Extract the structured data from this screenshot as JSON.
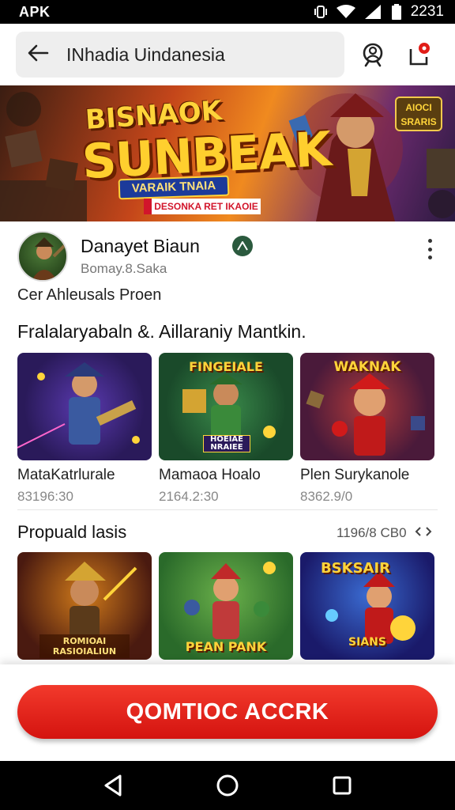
{
  "status_bar": {
    "left_text": "APK",
    "time": "2231"
  },
  "header": {
    "search_text": "INhadia Uindanesia"
  },
  "banner": {
    "title_top": "BISNAOK",
    "title_main": "SUNBEAK",
    "ribbon_text": "VARAIK TNAIA",
    "red_text": "DESONKA RET IKAOIE",
    "badge_text": "AIOCI SRARIS"
  },
  "developer": {
    "name": "Danayet Biaun",
    "subtitle": "Bomay.8.Saka",
    "category": "Cer Ahleusals Proen"
  },
  "featured": {
    "title": "Fralalaryabaln &. Aillaraniy Mantkin.",
    "items": [
      {
        "name": "MataKatrlurale",
        "meta": "83196:30"
      },
      {
        "name": "Mamaoa Hoalo",
        "meta": "2164.2:30"
      },
      {
        "name": "Plen Surykanole",
        "meta": "8362.9/0"
      }
    ],
    "art_labels": [
      "",
      "FINGEIALE",
      "WAKNAK"
    ],
    "art_sublabels": [
      "",
      "HOEIAE NRAIEE",
      ""
    ]
  },
  "popular": {
    "title": "Propuald lasis",
    "right_text": "1196/8 CB0",
    "art_labels": [
      "ROMIOAI RASIOIALIUN",
      "PEAN PANK",
      "BSKSAIR"
    ],
    "art_sublabels": [
      "",
      "",
      "SIANS"
    ]
  },
  "cta": {
    "label": "QOMTIOC ACCRK"
  },
  "colors": {
    "accent": "#e11d17",
    "banner_gold": "#ffcf2e",
    "verified": "#2b5a3e"
  }
}
